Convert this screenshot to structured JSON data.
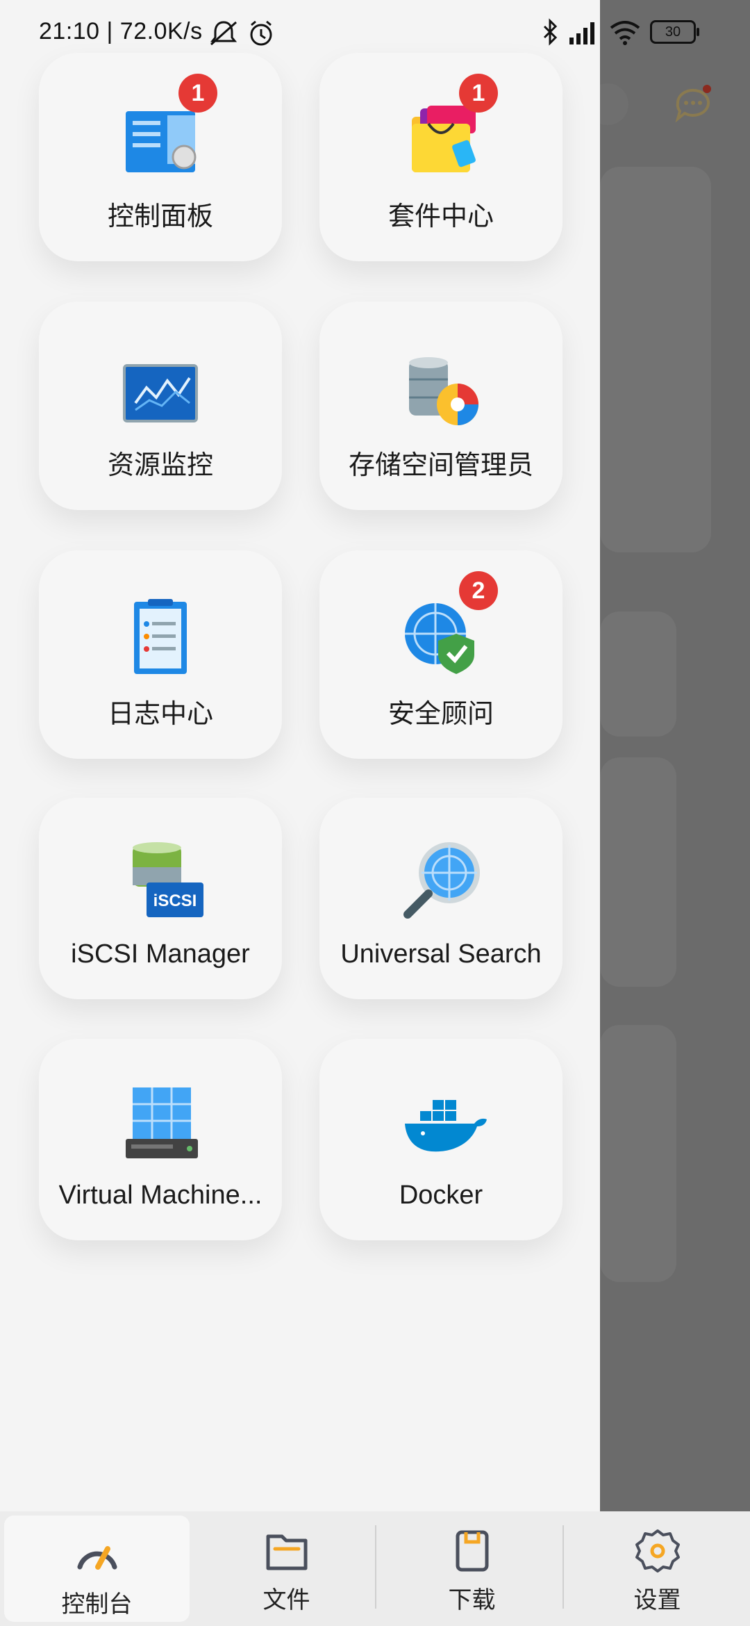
{
  "status_bar": {
    "time_speed": "21:10 | 72.0K/s",
    "battery": "30"
  },
  "apps": [
    {
      "label": "控制面板",
      "badge": "1",
      "icon": "control-panel-icon"
    },
    {
      "label": "套件中心",
      "badge": "1",
      "icon": "package-center-icon"
    },
    {
      "label": "资源监控",
      "badge": "",
      "icon": "resource-monitor-icon"
    },
    {
      "label": "存储空间管理员",
      "badge": "",
      "icon": "storage-manager-icon"
    },
    {
      "label": "日志中心",
      "badge": "",
      "icon": "log-center-icon"
    },
    {
      "label": "安全顾问",
      "badge": "2",
      "icon": "security-advisor-icon"
    },
    {
      "label": "iSCSI Manager",
      "badge": "",
      "icon": "iscsi-manager-icon"
    },
    {
      "label": "Universal Search",
      "badge": "",
      "icon": "universal-search-icon"
    },
    {
      "label": "Virtual Machine...",
      "badge": "",
      "icon": "virtual-machine-icon"
    },
    {
      "label": "Docker",
      "badge": "",
      "icon": "docker-icon"
    }
  ],
  "bottom_nav": [
    {
      "label": "控制台",
      "icon": "dashboard-gauge-icon",
      "active": true
    },
    {
      "label": "文件",
      "icon": "folder-icon",
      "active": false
    },
    {
      "label": "下载",
      "icon": "download-icon",
      "active": false
    },
    {
      "label": "设置",
      "icon": "settings-gear-icon",
      "active": false
    }
  ],
  "colors": {
    "accent": "#f5a623",
    "badge": "#e53935",
    "overlay": "#6b6b6b"
  }
}
